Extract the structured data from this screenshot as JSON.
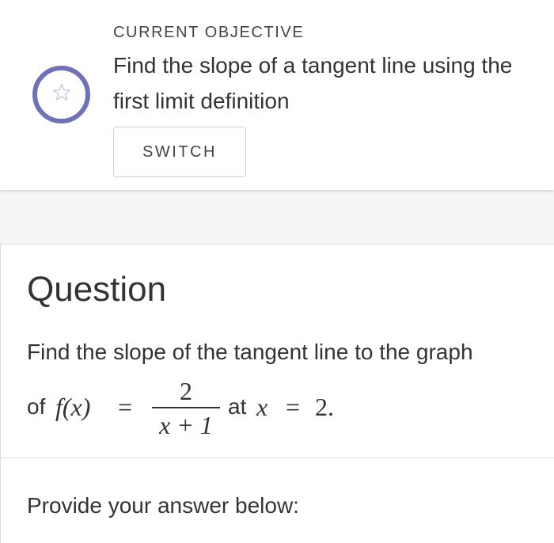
{
  "objective": {
    "heading": "CURRENT OBJECTIVE",
    "text": "Find the slope of a tangent line using the first limit definition",
    "switch_label": "SWITCH",
    "badge_icon": "star-icon",
    "accent_color": "#6f72b8"
  },
  "question": {
    "title": "Question",
    "line1": "Find the slope of the tangent line to the graph",
    "line2_prefix": "of",
    "function_lhs": "f(x)",
    "equals": "=",
    "numerator": "2",
    "denominator": "x + 1",
    "at_label": "at",
    "at_variable": "x",
    "at_equals": "=",
    "at_value": "2."
  },
  "answer": {
    "prompt": "Provide your answer below:"
  }
}
